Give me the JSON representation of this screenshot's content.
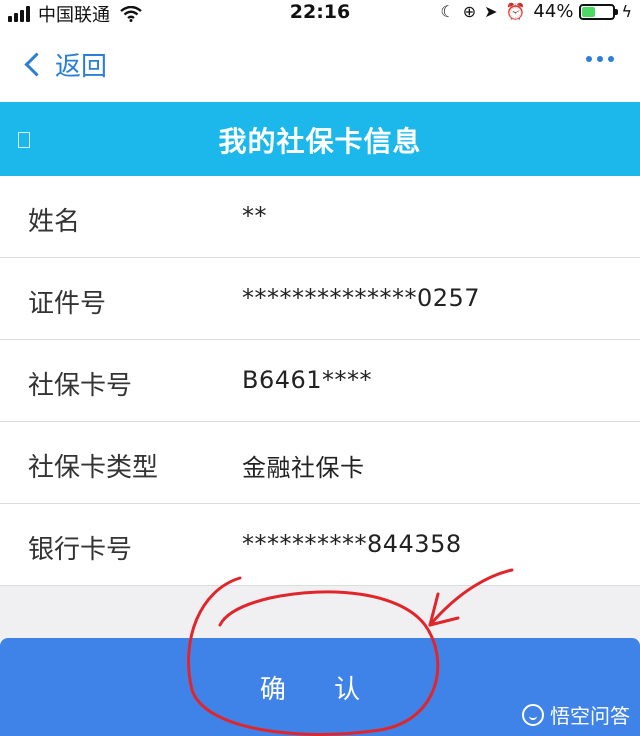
{
  "status_bar": {
    "carrier": "中国联通",
    "time": "22:16",
    "battery": "44%",
    "battery_level": 0.44,
    "battery_color": "#4cd964"
  },
  "nav": {
    "back_label": "返回",
    "more_icon": "more-dots-icon"
  },
  "title": "我的社保卡信息",
  "rows": [
    {
      "label": "姓名",
      "value": "**"
    },
    {
      "label": "证件号",
      "value": "**************0257"
    },
    {
      "label": "社保卡号",
      "value": "B6461****"
    },
    {
      "label": "社保卡类型",
      "value": "金融社保卡"
    },
    {
      "label": "银行卡号",
      "value": "**********844358"
    }
  ],
  "confirm_label": "确 认",
  "watermark": "悟空问答",
  "colors": {
    "accent": "#2b7fd6",
    "title_bar": "#1cb8ec",
    "confirm_button": "#3f83e8",
    "annotation": "#e0262b"
  }
}
